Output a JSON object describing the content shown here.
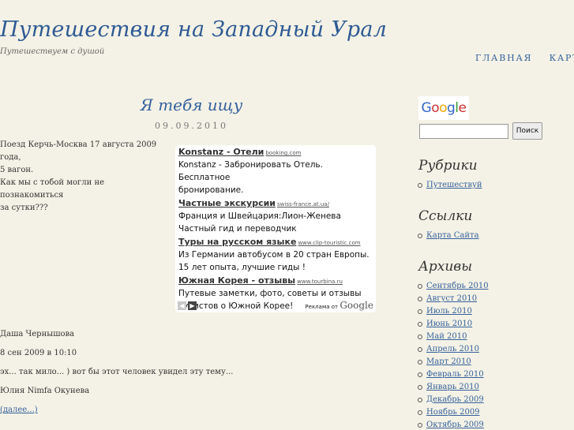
{
  "site": {
    "title": "Путешествия на Западный Урал",
    "tagline": "Путешествуем с душой"
  },
  "nav": [
    "ГЛАВНАЯ",
    "КАРТА"
  ],
  "post": {
    "title": "Я тебя ищу",
    "date": "09.09.2010",
    "lines": [
      "Поезд Керчь-Москва 17 августа 2009 года,",
      "5 вагон.",
      "Как мы с тобой могли не познакомиться",
      "за сутки???"
    ]
  },
  "ads": {
    "items": [
      {
        "title": "Konstanz - Отели",
        "url": "booking.com",
        "desc": [
          "Konstanz - Забронировать Отель. Бесплатное",
          "бронирование."
        ]
      },
      {
        "title": "Частные экскурсии",
        "url": "swiss-france.at.ua/",
        "desc": [
          "Франция и Швейцария:Лион-Женева",
          "Частный гид и переводчик"
        ]
      },
      {
        "title": "Туры на русском языке",
        "url": "www.clip-touristic.com",
        "desc": [
          "Из Германии автобусом в 20 стран Европы.",
          "15 лет опыта, лучшие гиды !"
        ]
      },
      {
        "title": "Южная Корея - отзывы",
        "url": "www.tourbina.ru",
        "desc": [
          "Путевые заметки, фото, советы и отзывы",
          "туристов о Южной Корее!"
        ]
      }
    ],
    "prev": "◀",
    "next": "▶",
    "by_text": "Реклама от",
    "by_brand": "Google"
  },
  "comment": {
    "author": "Даша Чернышова",
    "date": "8 сен 2009 в 10:10",
    "text": "эх... так мило... ) вот бы этот человек увидел эту тему...",
    "reply_author": "Юлия Nimfa Окунева",
    "more": "(далее...)"
  },
  "sidebar": {
    "google_logo": "Google",
    "search_placeholder": "",
    "search_button": "Поиск",
    "rubrics_title": "Рубрики",
    "rubrics": [
      "Путешествуй"
    ],
    "links_title": "Ссылки",
    "links": [
      "Карта Сайта"
    ],
    "archives_title": "Архивы",
    "archives": [
      "Сентябрь 2010",
      "Август 2010",
      "Июль 2010",
      "Июнь 2010",
      "Май 2010",
      "Апрель 2010",
      "Март 2010",
      "Февраль 2010",
      "Январь 2010",
      "Декабрь 2009",
      "Ноябрь 2009",
      "Октябрь 2009"
    ]
  },
  "colors": {
    "background": "#f4f2e6",
    "link": "#35619c",
    "google_blue": "#3366cc",
    "google_red": "#cc3333",
    "google_yellow": "#eeaa00",
    "google_green": "#339933"
  }
}
